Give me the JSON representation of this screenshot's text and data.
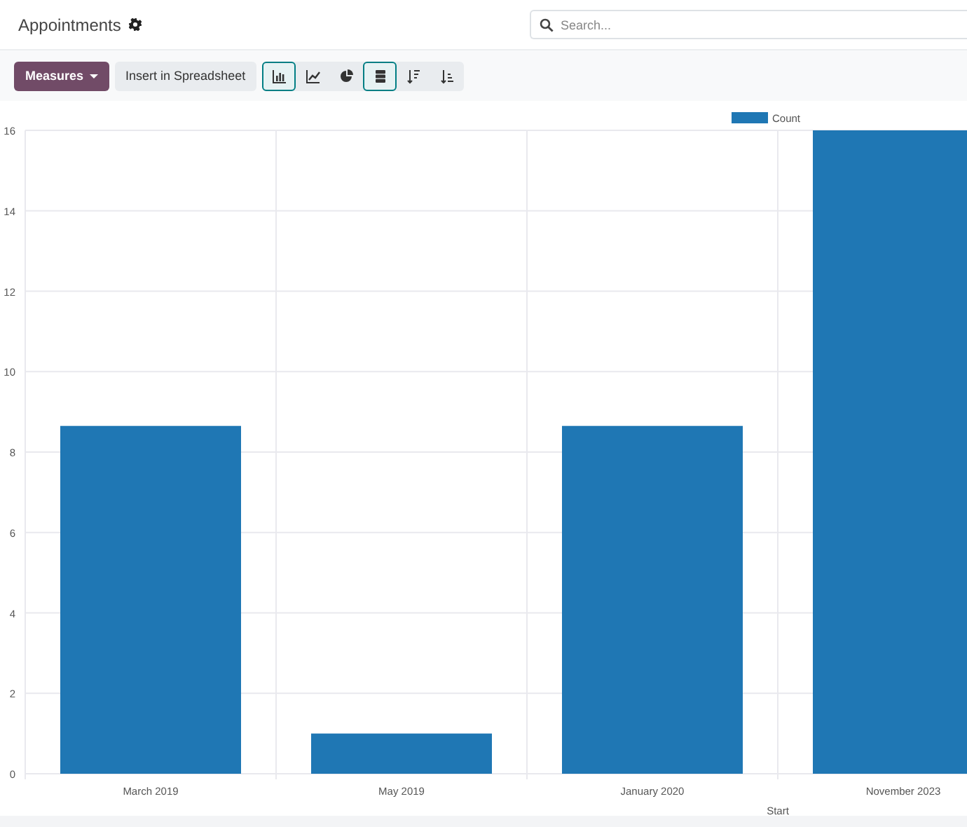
{
  "header": {
    "title": "Appointments",
    "search": {
      "placeholder": "Search..."
    }
  },
  "toolbar": {
    "measures": "Measures",
    "insert": "Insert in Spreadsheet",
    "view_buttons": [
      {
        "kind": "bar",
        "selected": true
      },
      {
        "kind": "line",
        "selected": false
      },
      {
        "kind": "pie",
        "selected": false
      },
      {
        "kind": "stacked",
        "selected": true
      },
      {
        "kind": "sort-desc",
        "selected": false
      },
      {
        "kind": "sort-asc",
        "selected": false
      }
    ]
  },
  "chart": {
    "chart_data": {
      "type": "bar",
      "xlabel": "Start",
      "categories": [
        "March 2019",
        "May 2019",
        "January 2020",
        "November 2023"
      ],
      "series": [
        {
          "name": "Count",
          "color": "#1f77b4",
          "values": [
            8.65,
            1,
            8.65,
            16
          ]
        }
      ],
      "grid": true,
      "ylim": [
        0,
        16
      ],
      "yticks": [
        0,
        2,
        4,
        6,
        8,
        10,
        12,
        14,
        16
      ]
    }
  }
}
